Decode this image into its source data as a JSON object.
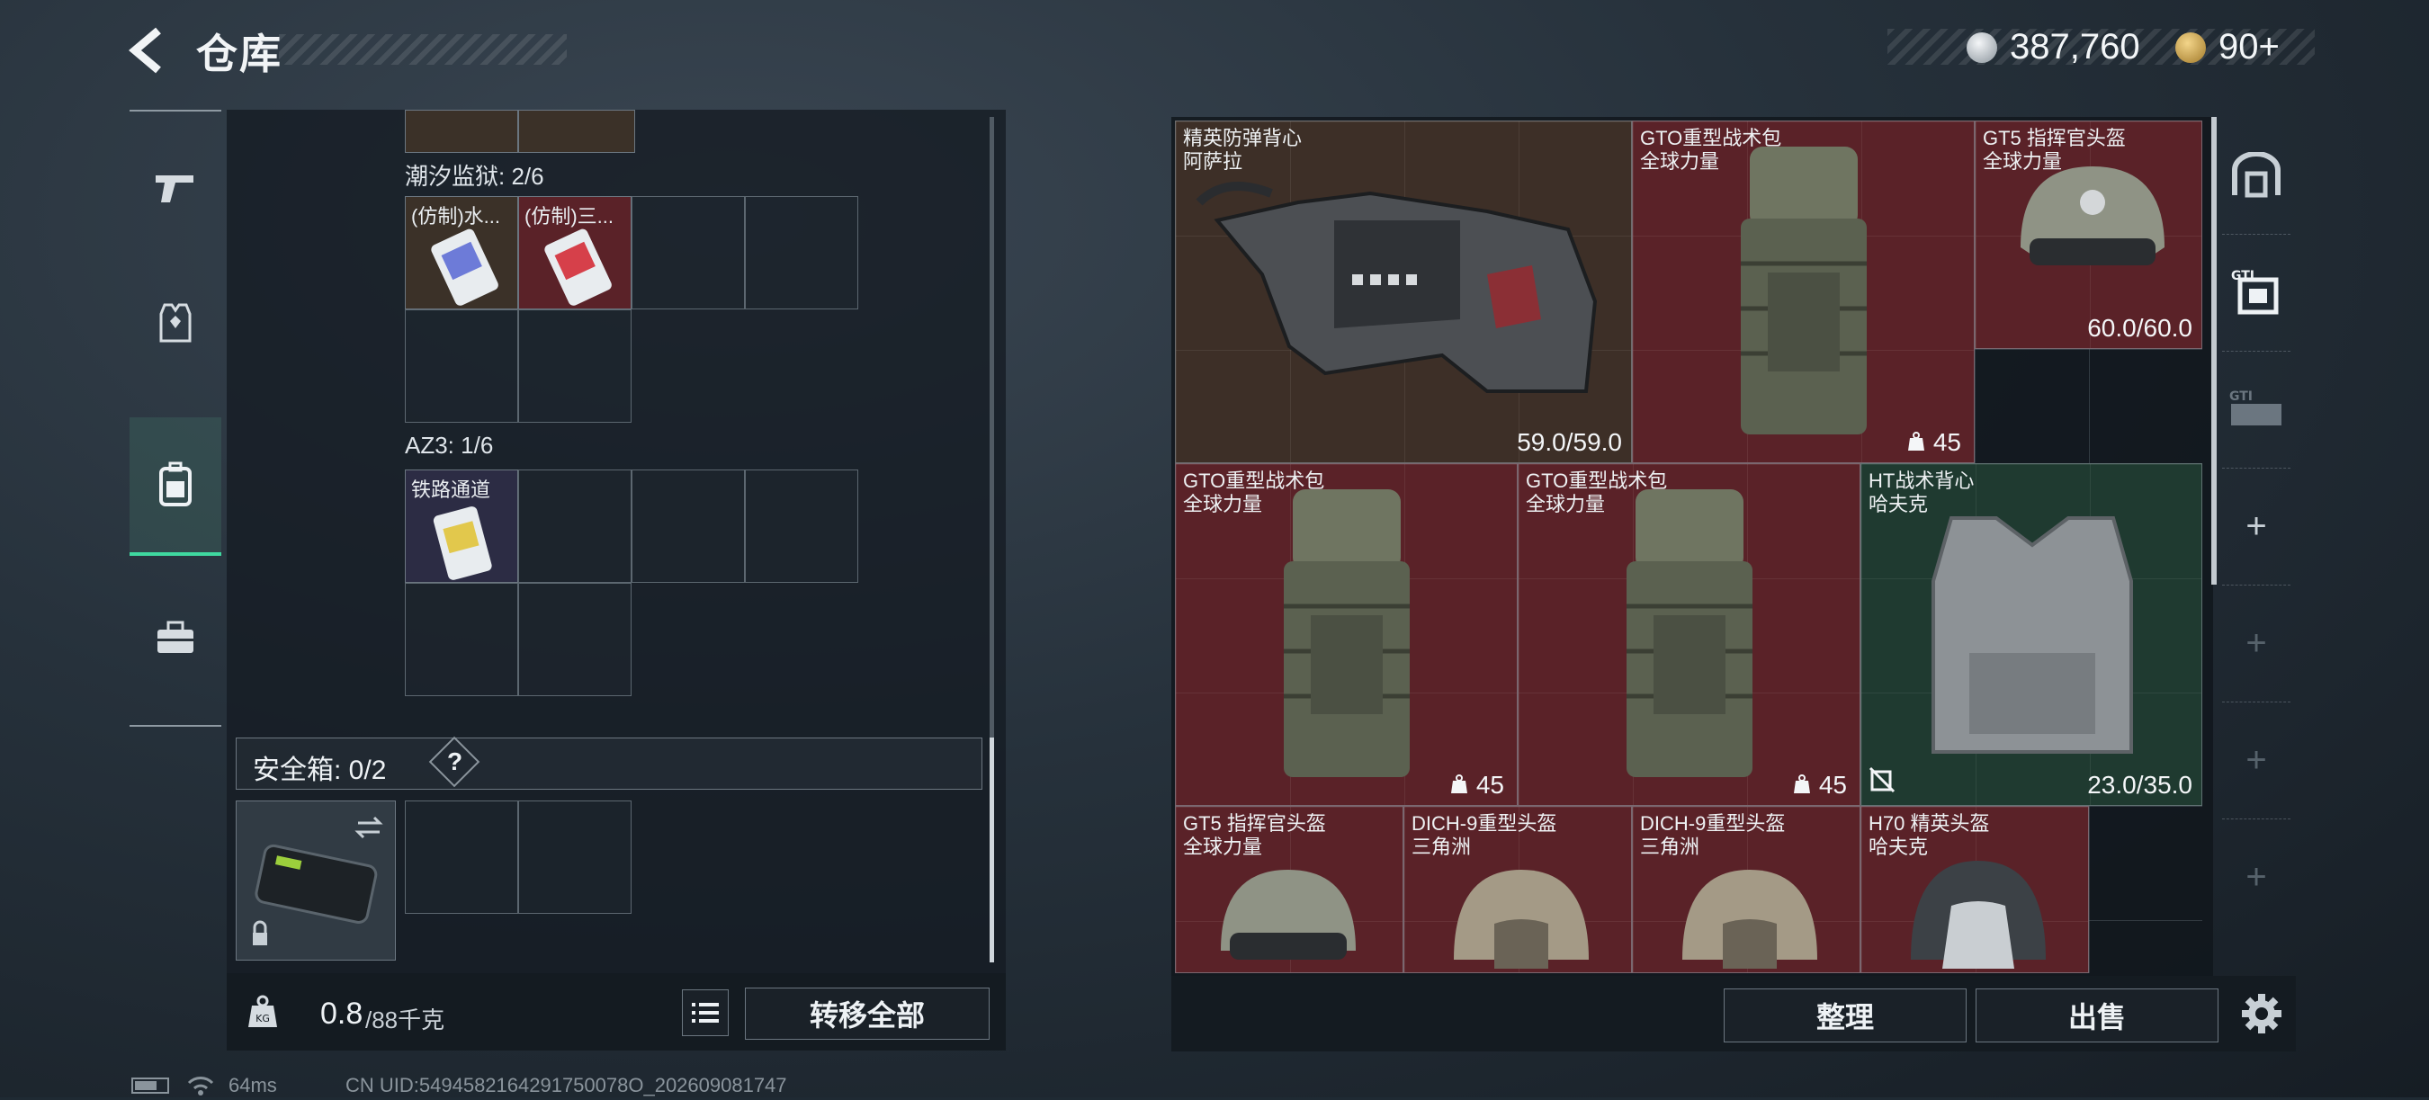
{
  "header": {
    "title": "仓库",
    "currency1": "387,760",
    "currency2": "90+"
  },
  "left": {
    "section1": {
      "label": "潮汐监狱: 2/6",
      "items": [
        "(仿制)水...",
        "(仿制)三..."
      ]
    },
    "section2": {
      "label": "AZ3: 1/6",
      "items": [
        "铁路通道"
      ]
    },
    "safe": {
      "label": "安全箱: 0/2",
      "help": "?"
    },
    "weight": {
      "value": "0.8",
      "unit": "/88千克"
    },
    "transfer_all": "转移全部"
  },
  "right": {
    "items": [
      {
        "name": "精英防弹背心",
        "brand": "阿萨拉",
        "stat": "59.0/59.0",
        "rarity_color": "#3d2f27"
      },
      {
        "name": "GTO重型战术包",
        "brand": "全球力量",
        "stat": "45",
        "rarity_color": "#5a2228"
      },
      {
        "name": "GT5 指挥官头盔",
        "brand": "全球力量",
        "stat": "60.0/60.0",
        "rarity_color": "#5a2228"
      },
      {
        "name": "GTO重型战术包",
        "brand": "全球力量",
        "stat": "45",
        "rarity_color": "#5a2228"
      },
      {
        "name": "GTO重型战术包",
        "brand": "全球力量",
        "stat": "45",
        "rarity_color": "#5a2228"
      },
      {
        "name": "HT战术背心",
        "brand": "哈夫克",
        "stat": "23.0/35.0",
        "rarity_color": "#1f3a30"
      },
      {
        "name": "GT5 指挥官头盔",
        "brand": "全球力量",
        "stat": "",
        "rarity_color": "#5a2228"
      },
      {
        "name": "DICH-9重型头盔",
        "brand": "三角洲",
        "stat": "",
        "rarity_color": "#5a2228"
      },
      {
        "name": "DICH-9重型头盔",
        "brand": "三角洲",
        "stat": "",
        "rarity_color": "#5a2228"
      },
      {
        "name": "H70 精英头盔",
        "brand": "哈夫克",
        "stat": "",
        "rarity_color": "#5a2228"
      }
    ],
    "sort_button": "整理",
    "sell_button": "出售"
  },
  "footer": {
    "ping": "64ms",
    "uid": "CN UID:5494582164291750078O_202609081747"
  }
}
